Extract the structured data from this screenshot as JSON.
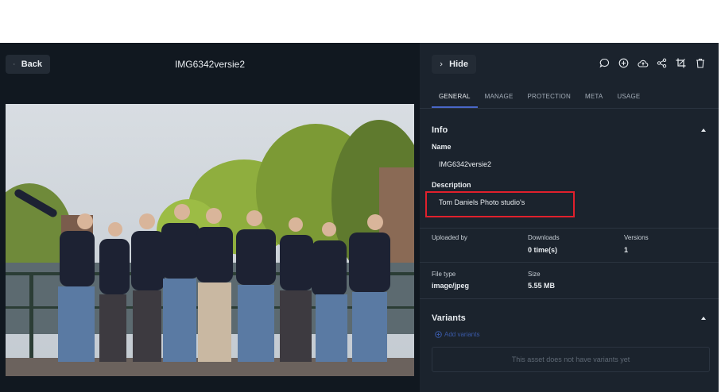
{
  "header": {
    "back_label": "Back",
    "title": "IMG6342versie2",
    "hide_label": "Hide"
  },
  "toolbar_icons": [
    "comment-icon",
    "add-circle-icon",
    "cloud-upload-icon",
    "share-icon",
    "crop-icon",
    "trash-icon"
  ],
  "tabs": [
    {
      "label": "GENERAL",
      "active": true
    },
    {
      "label": "MANAGE",
      "active": false
    },
    {
      "label": "PROTECTION",
      "active": false
    },
    {
      "label": "META",
      "active": false
    },
    {
      "label": "USAGE",
      "active": false
    }
  ],
  "info": {
    "section_title": "Info",
    "name_label": "Name",
    "name_value": "IMG6342versie2",
    "description_label": "Description",
    "description_value": "Tom Daniels Photo studio's"
  },
  "stats": {
    "uploaded_by_label": "Uploaded by",
    "uploaded_by_value": "",
    "downloads_label": "Downloads",
    "downloads_value": "0 time(s)",
    "versions_label": "Versions",
    "versions_value": "1",
    "file_type_label": "File type",
    "file_type_value": "image/jpeg",
    "size_label": "Size",
    "size_value": "5.55 MB"
  },
  "variants": {
    "section_title": "Variants",
    "add_label": "Add variants",
    "empty_text": "This asset does not have variants yet"
  },
  "colors": {
    "background": "#111820",
    "panel": "#1b232d",
    "accent": "#4a67c8",
    "highlight": "#e0202c"
  }
}
